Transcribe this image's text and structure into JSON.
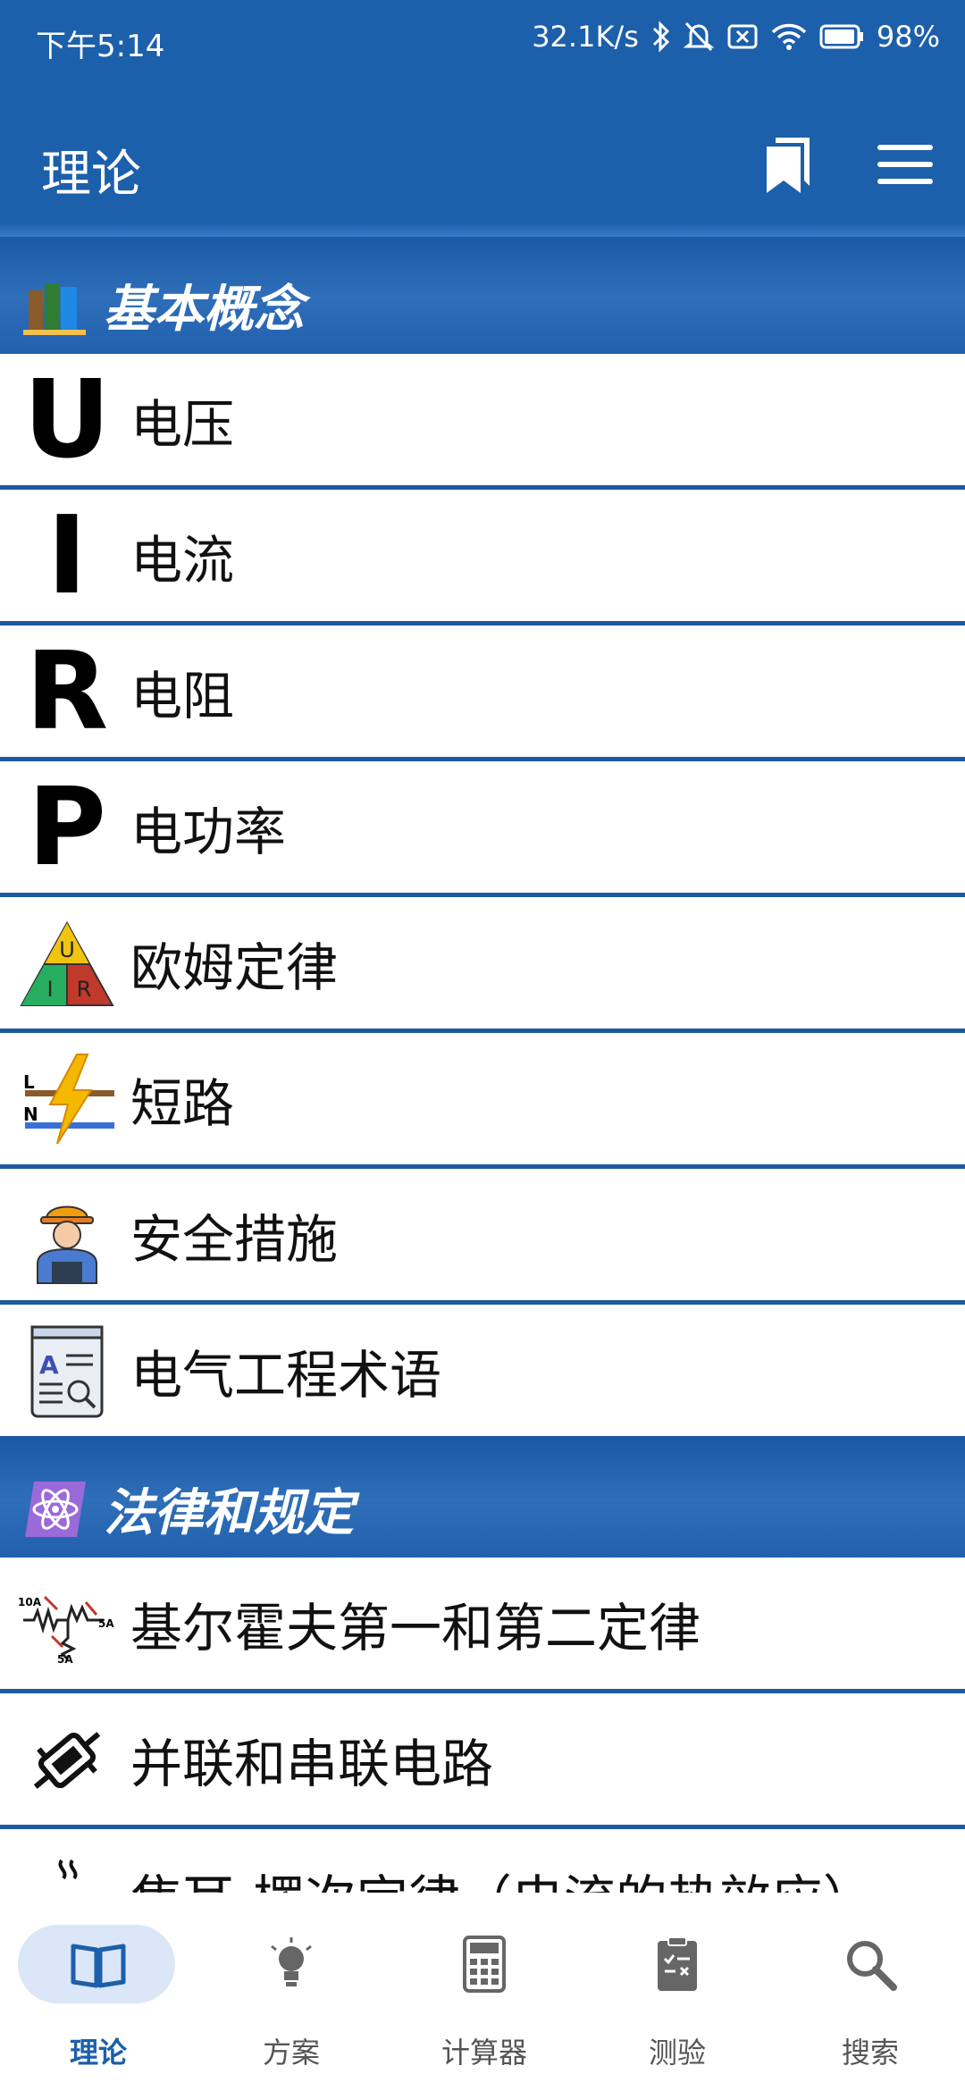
{
  "status_bar": {
    "time": "下午5:14",
    "network_speed": "32.1K/s",
    "battery": "98%"
  },
  "app_bar": {
    "title": "理论"
  },
  "sections": [
    {
      "title": "基本概念",
      "items": [
        {
          "icon_text": "U",
          "label": "电压"
        },
        {
          "icon_text": "I",
          "label": "电流"
        },
        {
          "icon_text": "R",
          "label": "电阻"
        },
        {
          "icon_text": "P",
          "label": "电功率"
        },
        {
          "icon": "ohm-triangle-icon",
          "label": "欧姆定律"
        },
        {
          "icon": "lightning-icon",
          "label": "短路"
        },
        {
          "icon": "worker-icon",
          "label": "安全措施"
        },
        {
          "icon": "glossary-book-icon",
          "label": "电气工程术语"
        }
      ]
    },
    {
      "title": "法律和规定",
      "items": [
        {
          "icon": "kirchhoff-icon",
          "label": "基尔霍夫第一和第二定律"
        },
        {
          "icon": "circuit-icon",
          "label": "并联和串联电路"
        },
        {
          "icon": "heat-icon",
          "label": "焦耳-楞次定律（电流的热效应）"
        }
      ]
    }
  ],
  "icon_labels": {
    "ohm_u": "U",
    "ohm_i": "I",
    "ohm_r": "R",
    "short_l": "L",
    "short_n": "N",
    "glossary_a": "A",
    "kirch_10a": "10A",
    "kirch_5a_1": "5A",
    "kirch_5a_2": "5A"
  },
  "bottom_nav": [
    {
      "label": "理论",
      "icon": "book-icon",
      "active": true
    },
    {
      "label": "方案",
      "icon": "lightbulb-icon",
      "active": false
    },
    {
      "label": "计算器",
      "icon": "calculator-icon",
      "active": false
    },
    {
      "label": "测验",
      "icon": "clipboard-icon",
      "active": false
    },
    {
      "label": "搜索",
      "icon": "search-icon",
      "active": false
    }
  ],
  "colors": {
    "primary": "#1c5fab",
    "divider": "#1c5aa0",
    "nav_active_bg": "#dbe6f8"
  }
}
